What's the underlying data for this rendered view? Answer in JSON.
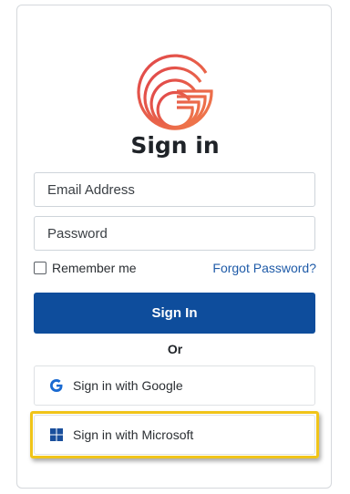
{
  "title": "Sign in",
  "form": {
    "email_placeholder": "Email Address",
    "password_placeholder": "Password",
    "remember_label": "Remember me",
    "remember_checked": false,
    "forgot_label": "Forgot Password?",
    "signin_label": "Sign In"
  },
  "divider": "Or",
  "sso": {
    "google_label": "Sign in with Google",
    "google_icon": "google-g-icon",
    "microsoft_label": "Sign in with Microsoft",
    "microsoft_icon": "microsoft-windows-icon"
  },
  "colors": {
    "primary_button": "#0e4d9c",
    "link": "#1f5ba8",
    "logo_red": "#e04a4a",
    "highlight": "#f0c419"
  }
}
